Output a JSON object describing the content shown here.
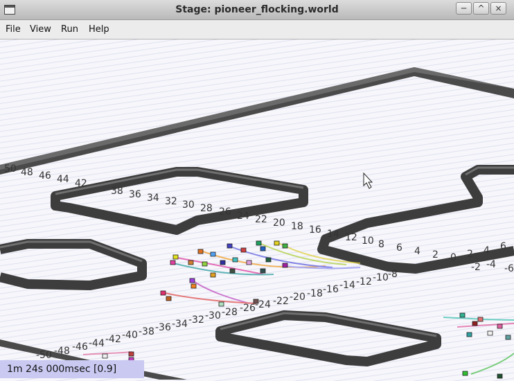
{
  "window": {
    "title": "Stage: pioneer_flocking.world",
    "buttons": {
      "minimize": "─",
      "maximize": "^",
      "close": "×"
    }
  },
  "menu": {
    "items": [
      "File",
      "View",
      "Run",
      "Help"
    ]
  },
  "status": {
    "time": "1m 24s 000msec [0.9]"
  },
  "ruler_labels": {
    "row1": [
      "50",
      "48",
      "46",
      "44",
      "42",
      "38",
      "36",
      "34",
      "32",
      "30",
      "28",
      "26",
      "24",
      "22",
      "20",
      "18",
      "16",
      "14",
      "12",
      "10",
      "8",
      "6",
      "4",
      "2",
      "0",
      "2",
      "4",
      "6"
    ],
    "row1_minus": [
      "-2",
      "-4",
      "-6"
    ],
    "row2": [
      "-24",
      "-22",
      "-20",
      "-18",
      "-16",
      "-14",
      "-12",
      "-10",
      "-8",
      "-26",
      "-28",
      "-30",
      "-32",
      "-34",
      "-36",
      "-38",
      "-40",
      "-42",
      "-44",
      "-46",
      "-48",
      "-50"
    ]
  },
  "icons": {
    "cursor": "mouse-pointer-icon"
  }
}
